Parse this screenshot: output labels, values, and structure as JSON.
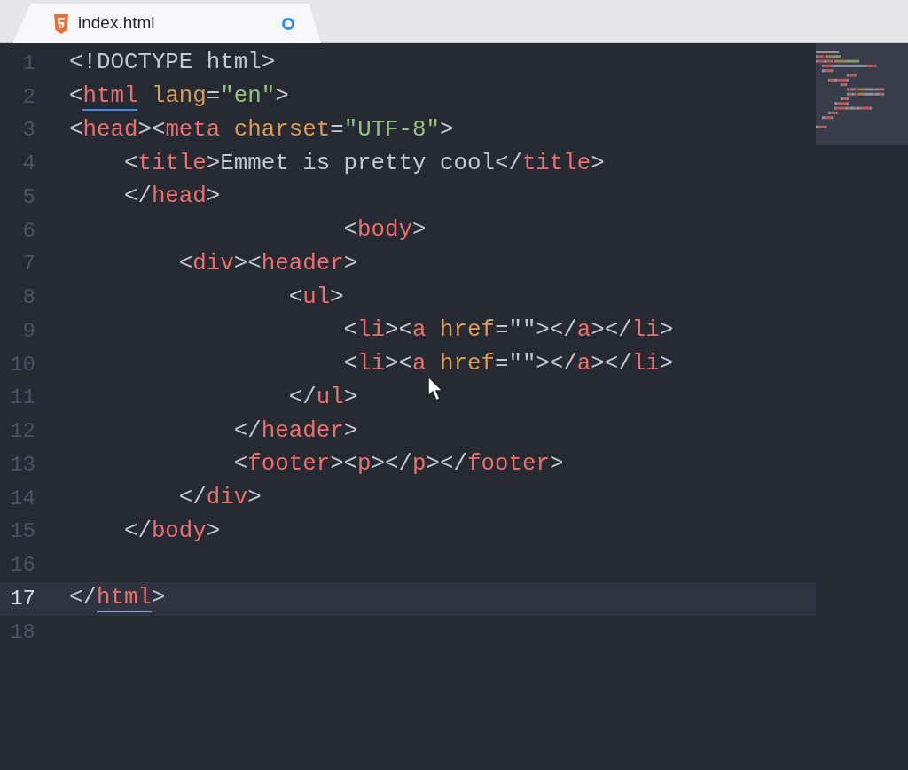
{
  "tab": {
    "title": "index.html",
    "modified": true,
    "selected": true
  },
  "lines": [
    {
      "number": "1",
      "current": false,
      "tokens": [
        {
          "kind": "punct",
          "text": "<!DOCTYPE html>"
        }
      ]
    },
    {
      "number": "2",
      "current": false,
      "tokens": [
        {
          "kind": "punct",
          "text": "<"
        },
        {
          "kind": "tag",
          "text": "html",
          "matched": true
        },
        {
          "kind": "attr",
          "text": " lang"
        },
        {
          "kind": "punct",
          "text": "="
        },
        {
          "kind": "string",
          "text": "\"en\""
        },
        {
          "kind": "punct",
          "text": ">"
        }
      ]
    },
    {
      "number": "3",
      "current": false,
      "tokens": [
        {
          "kind": "punct",
          "text": "<"
        },
        {
          "kind": "tag",
          "text": "head"
        },
        {
          "kind": "punct",
          "text": "><"
        },
        {
          "kind": "tag",
          "text": "meta"
        },
        {
          "kind": "attr",
          "text": " charset"
        },
        {
          "kind": "punct",
          "text": "="
        },
        {
          "kind": "string",
          "text": "\"UTF-8\""
        },
        {
          "kind": "punct",
          "text": ">"
        }
      ]
    },
    {
      "number": "4",
      "current": false,
      "tokens": [
        {
          "kind": "punct",
          "text": "    <"
        },
        {
          "kind": "tag",
          "text": "title"
        },
        {
          "kind": "punct",
          "text": ">"
        },
        {
          "kind": "text",
          "text": "Emmet is pretty cool"
        },
        {
          "kind": "punct",
          "text": "</"
        },
        {
          "kind": "tag",
          "text": "title"
        },
        {
          "kind": "punct",
          "text": ">"
        }
      ]
    },
    {
      "number": "5",
      "current": false,
      "tokens": [
        {
          "kind": "punct",
          "text": "    </"
        },
        {
          "kind": "tag",
          "text": "head"
        },
        {
          "kind": "punct",
          "text": ">"
        }
      ]
    },
    {
      "number": "6",
      "current": false,
      "tokens": [
        {
          "kind": "punct",
          "text": "                    <"
        },
        {
          "kind": "tag",
          "text": "body"
        },
        {
          "kind": "punct",
          "text": ">"
        }
      ]
    },
    {
      "number": "7",
      "current": false,
      "tokens": [
        {
          "kind": "punct",
          "text": "        <"
        },
        {
          "kind": "tag",
          "text": "div"
        },
        {
          "kind": "punct",
          "text": "><"
        },
        {
          "kind": "tag",
          "text": "header"
        },
        {
          "kind": "punct",
          "text": ">"
        }
      ]
    },
    {
      "number": "8",
      "current": false,
      "tokens": [
        {
          "kind": "punct",
          "text": "                <"
        },
        {
          "kind": "tag",
          "text": "ul"
        },
        {
          "kind": "punct",
          "text": ">"
        }
      ]
    },
    {
      "number": "9",
      "current": false,
      "tokens": [
        {
          "kind": "punct",
          "text": "                    <"
        },
        {
          "kind": "tag",
          "text": "li"
        },
        {
          "kind": "punct",
          "text": "><"
        },
        {
          "kind": "tag",
          "text": "a"
        },
        {
          "kind": "attr",
          "text": " href"
        },
        {
          "kind": "punct",
          "text": "=\"\"></"
        },
        {
          "kind": "tag",
          "text": "a"
        },
        {
          "kind": "punct",
          "text": "></"
        },
        {
          "kind": "tag",
          "text": "li"
        },
        {
          "kind": "punct",
          "text": ">"
        }
      ]
    },
    {
      "number": "10",
      "current": false,
      "tokens": [
        {
          "kind": "punct",
          "text": "                    <"
        },
        {
          "kind": "tag",
          "text": "li"
        },
        {
          "kind": "punct",
          "text": "><"
        },
        {
          "kind": "tag",
          "text": "a"
        },
        {
          "kind": "attr",
          "text": " href"
        },
        {
          "kind": "punct",
          "text": "=\"\"></"
        },
        {
          "kind": "tag",
          "text": "a"
        },
        {
          "kind": "punct",
          "text": "></"
        },
        {
          "kind": "tag",
          "text": "li"
        },
        {
          "kind": "punct",
          "text": ">"
        }
      ]
    },
    {
      "number": "11",
      "current": false,
      "tokens": [
        {
          "kind": "punct",
          "text": "                </"
        },
        {
          "kind": "tag",
          "text": "ul"
        },
        {
          "kind": "punct",
          "text": ">"
        }
      ]
    },
    {
      "number": "12",
      "current": false,
      "tokens": [
        {
          "kind": "punct",
          "text": "            </"
        },
        {
          "kind": "tag",
          "text": "header"
        },
        {
          "kind": "punct",
          "text": ">"
        }
      ]
    },
    {
      "number": "13",
      "current": false,
      "tokens": [
        {
          "kind": "punct",
          "text": "            <"
        },
        {
          "kind": "tag",
          "text": "footer"
        },
        {
          "kind": "punct",
          "text": "><"
        },
        {
          "kind": "tag",
          "text": "p"
        },
        {
          "kind": "punct",
          "text": "></"
        },
        {
          "kind": "tag",
          "text": "p"
        },
        {
          "kind": "punct",
          "text": "></"
        },
        {
          "kind": "tag",
          "text": "footer"
        },
        {
          "kind": "punct",
          "text": ">"
        }
      ]
    },
    {
      "number": "14",
      "current": false,
      "tokens": [
        {
          "kind": "punct",
          "text": "        </"
        },
        {
          "kind": "tag",
          "text": "div"
        },
        {
          "kind": "punct",
          "text": ">"
        }
      ]
    },
    {
      "number": "15",
      "current": false,
      "tokens": [
        {
          "kind": "punct",
          "text": "    </"
        },
        {
          "kind": "tag",
          "text": "body"
        },
        {
          "kind": "punct",
          "text": ">"
        }
      ]
    },
    {
      "number": "16",
      "current": false
    },
    {
      "number": "17",
      "current": true,
      "tokens": [
        {
          "kind": "punct",
          "text": "</"
        },
        {
          "kind": "tag",
          "text": "html",
          "matched": true
        },
        {
          "kind": "punct",
          "text": ">"
        }
      ]
    },
    {
      "number": "18",
      "current": false
    }
  ]
}
